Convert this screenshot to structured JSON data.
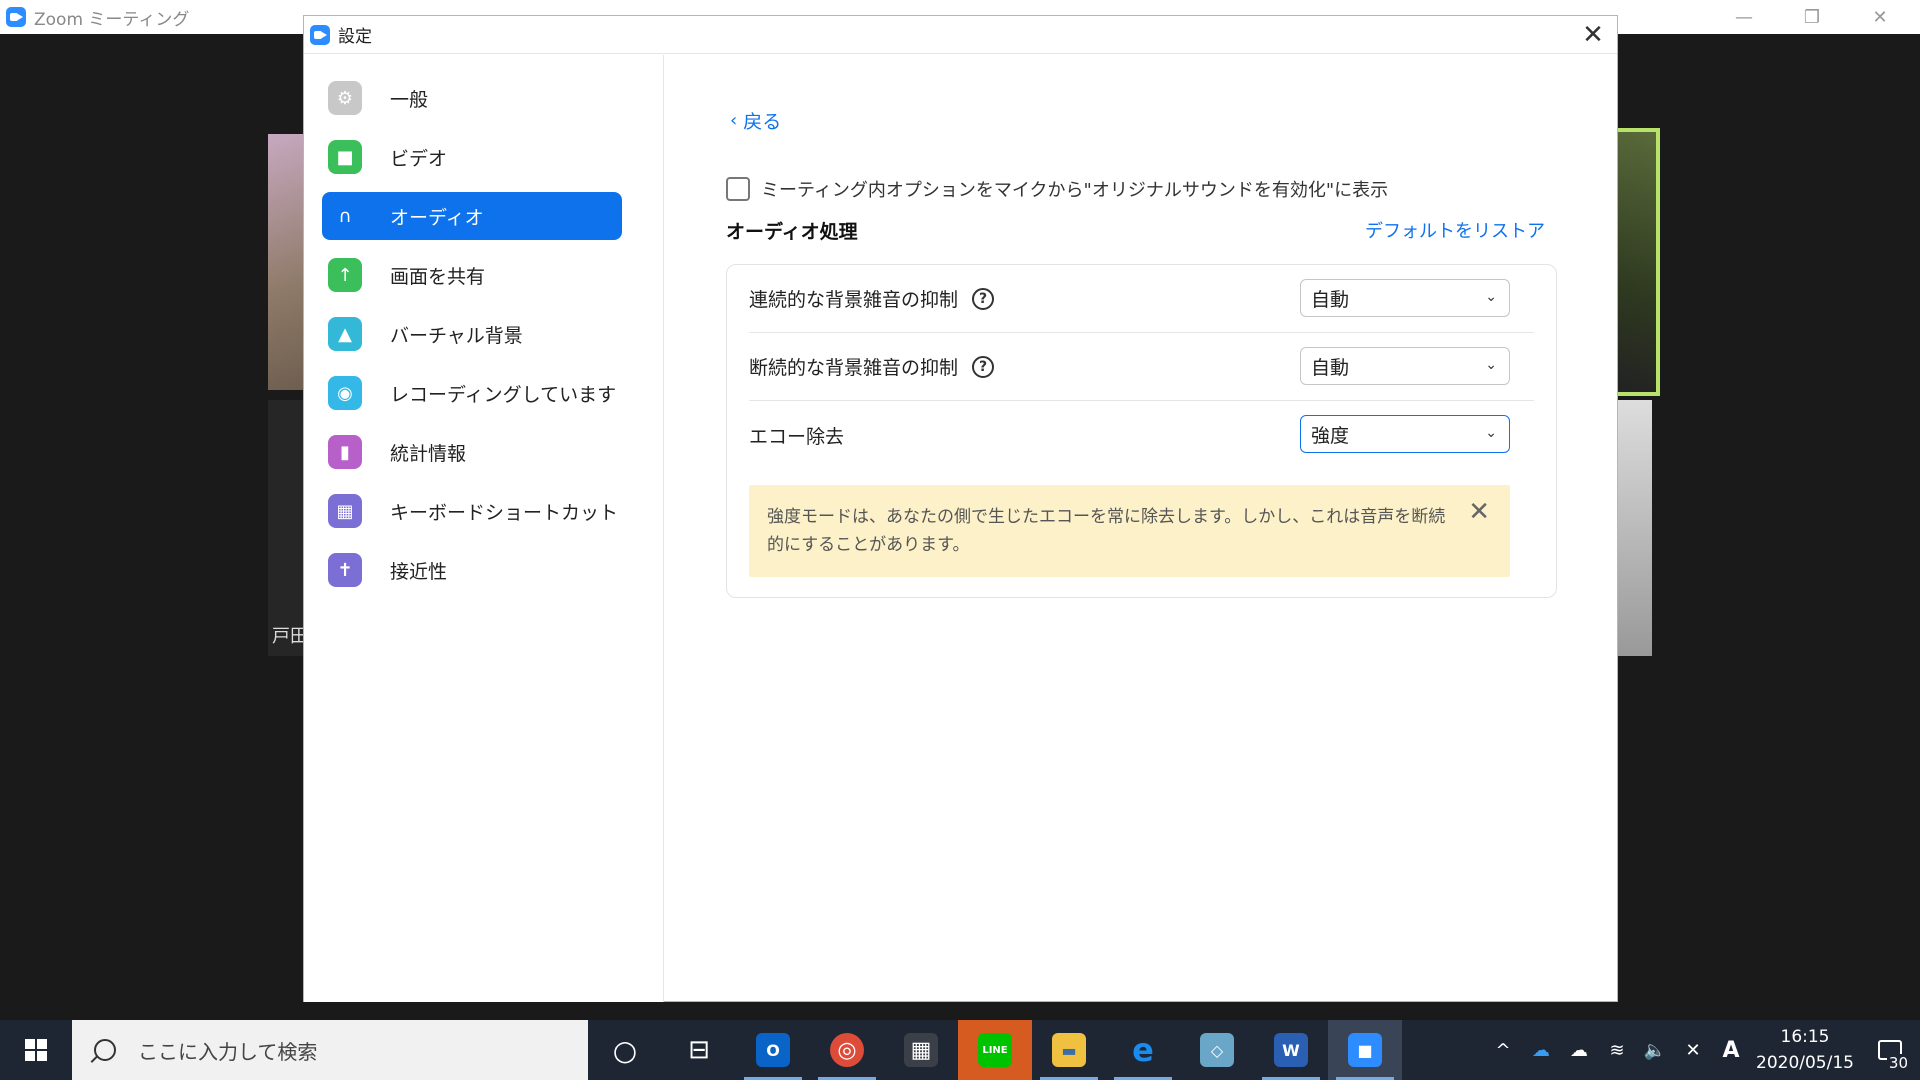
{
  "zoom_window": {
    "title": "Zoom ミーティング",
    "participant_name": "戸田",
    "minimize_glyph": "—",
    "restore_glyph": "❐",
    "close_glyph": "✕"
  },
  "settings": {
    "title": "設定",
    "close_glyph": "✕",
    "sidebar": {
      "items": [
        {
          "label": "一般",
          "icon": "gear-icon",
          "color": "#c8c8c8",
          "glyph": "⚙"
        },
        {
          "label": "ビデオ",
          "icon": "video-camera-icon",
          "color": "#3bbf5a",
          "glyph": "■"
        },
        {
          "label": "オーディオ",
          "icon": "headphones-icon",
          "color": "#0e72ed",
          "glyph": "∩",
          "active": true
        },
        {
          "label": "画面を共有",
          "icon": "share-screen-icon",
          "color": "#3bbf5a",
          "glyph": "↑"
        },
        {
          "label": "バーチャル背景",
          "icon": "virtual-background-icon",
          "color": "#33b8d8",
          "glyph": "▲"
        },
        {
          "label": "レコーディングしています",
          "icon": "recording-icon",
          "color": "#33b8e8",
          "glyph": "◉"
        },
        {
          "label": "統計情報",
          "icon": "statistics-icon",
          "color": "#b760c9",
          "glyph": "▮"
        },
        {
          "label": "キーボードショートカット",
          "icon": "keyboard-icon",
          "color": "#7b6fd6",
          "glyph": "▦"
        },
        {
          "label": "接近性",
          "icon": "accessibility-icon",
          "color": "#7b6fd6",
          "glyph": "✝"
        }
      ]
    },
    "content": {
      "back_label": "戻る",
      "back_glyph": "‹",
      "original_sound_option": "ミーティング内オプションをマイクから\"オリジナルサウンドを有効化\"に表示",
      "section_title": "オーディオ処理",
      "restore_default": "デフォルトをリストア",
      "rows": [
        {
          "label": "連続的な背景雑音の抑制",
          "value": "自動",
          "help": "?"
        },
        {
          "label": "断続的な背景雑音の抑制",
          "value": "自動",
          "help": "?"
        },
        {
          "label": "エコー除去",
          "value": "強度"
        }
      ],
      "select_arrow": "⌄",
      "notice": "強度モードは、あなたの側で生じたエコーを常に除去します。しかし、これは音声を断続的にすることがあります。",
      "notice_close": "✕"
    }
  },
  "taskbar": {
    "search_placeholder": "ここに入力して検索",
    "apps": [
      {
        "name": "cortana",
        "glyph": "○",
        "color": "transparent"
      },
      {
        "name": "task-view",
        "glyph": "⊟",
        "color": "transparent"
      },
      {
        "name": "outlook",
        "glyph": "O",
        "color": "#0a64c8"
      },
      {
        "name": "chrome",
        "glyph": "◎",
        "color": "#dd4b39"
      },
      {
        "name": "calculator",
        "glyph": "▦",
        "color": "#3a3f48"
      },
      {
        "name": "line",
        "glyph": "LINE",
        "color": "#00c300"
      },
      {
        "name": "file-explorer",
        "glyph": "▬",
        "color": "#f0c040"
      },
      {
        "name": "edge",
        "glyph": "e",
        "color": "#1a73d9"
      },
      {
        "name": "notepad",
        "glyph": "◇",
        "color": "#6aa6c8"
      },
      {
        "name": "word",
        "glyph": "W",
        "color": "#2b5fb4"
      },
      {
        "name": "zoom",
        "glyph": "■",
        "color": "#2d8cff"
      }
    ],
    "tray": {
      "chevron": "^",
      "onedrive": "☁",
      "cloud": "☁",
      "wifi": "≋",
      "volume": "🔈",
      "pen": "✕",
      "ime": "A",
      "time": "16:15",
      "date": "2020/05/15",
      "notification_count": "30"
    }
  }
}
